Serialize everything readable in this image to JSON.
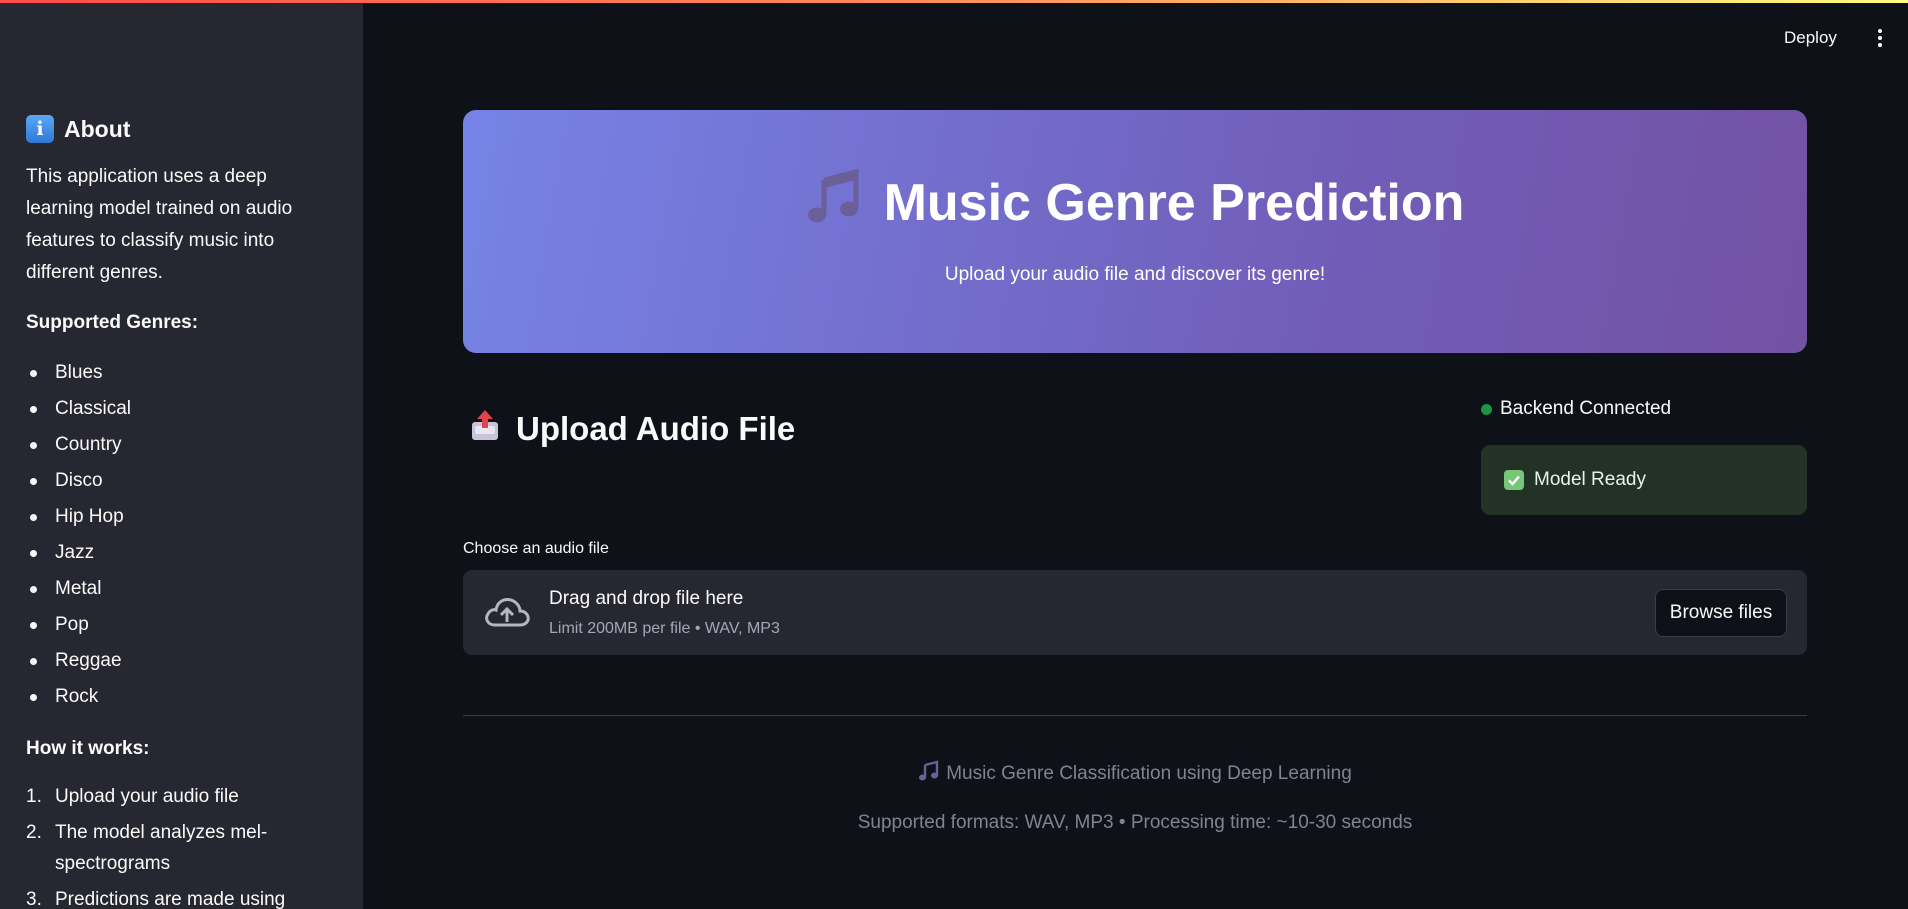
{
  "sidebar": {
    "about_heading": "About",
    "about_icon": "info-icon",
    "description": "This application uses a deep learning model trained on audio features to classify music into different genres.",
    "genres_heading": "Supported Genres:",
    "genres": [
      "Blues",
      "Classical",
      "Country",
      "Disco",
      "Hip Hop",
      "Jazz",
      "Metal",
      "Pop",
      "Reggae",
      "Rock"
    ],
    "how_heading": "How it works:",
    "steps": [
      {
        "num": "1.",
        "text": "Upload your audio file"
      },
      {
        "num": "2.",
        "text": "The model analyzes mel-spectrograms"
      },
      {
        "num": "3.",
        "text": "Predictions are made using"
      }
    ]
  },
  "header": {
    "deploy_label": "Deploy",
    "menu_icon": "kebab-menu-icon"
  },
  "hero": {
    "title": "Music Genre Prediction",
    "icon": "music-notes-icon",
    "subtitle": "Upload your audio file and discover its genre!"
  },
  "upload": {
    "heading": "Upload Audio File",
    "icon": "outbox-tray-icon",
    "field_label": "Choose an audio file",
    "drag_text": "Drag and drop file here",
    "limit_text": "Limit 200MB per file • WAV, MP3",
    "browse_label": "Browse files"
  },
  "status": {
    "backend_text": "Backend Connected",
    "model_text": "Model Ready",
    "colors": {
      "connected_dot": "#21c354",
      "model_bg": "#223326"
    }
  },
  "footer": {
    "line1": "Music Genre Classification using Deep Learning",
    "line2": "Supported formats: WAV, MP3 • Processing time: ~10-30 seconds"
  },
  "colors": {
    "background": "#0e1117",
    "sidebar": "#262730",
    "hero_gradient_start": "#7683e6",
    "hero_gradient_end": "#7352a4"
  }
}
